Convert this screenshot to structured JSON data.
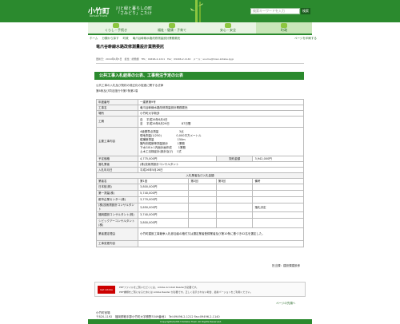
{
  "header": {
    "logo": "小竹町",
    "logo_sub": "KOTAKE TOWN",
    "tagline": "川と緑と暮らしの町「さみどり」こたけ",
    "search_placeholder": "検索キーワードを入力",
    "search_button": "検索"
  },
  "nav": [
    {
      "label": "くらし・手続き",
      "icon": "house-icon"
    },
    {
      "label": "福祉・健康・子育て",
      "icon": "people-icon"
    },
    {
      "label": "安心・安全",
      "icon": "shield-icon"
    },
    {
      "label": "町政",
      "icon": "building-icon"
    }
  ],
  "breadcrumb": [
    "ホーム",
    "分類から探す",
    "町政",
    "竜爪谷幹線水路改修測量設計業務委託"
  ],
  "print_link": "ページを印刷する",
  "page_title": "竜爪谷幹線水路改修測量設計業務委託",
  "meta_line": "更新日：2019年4月5日　担当：総務課　TEL：09496-2-1211　Fax：09496-2-1140　メール：soumu@town.kotake.lg.jp",
  "section_heading": "公共工事入札結果の公表、工事発注予定の公表",
  "intro": [
    "公共工事の入札及び契約の適正化の促進に関する法律",
    "第8条及び同法施行令第7条第2項"
  ],
  "table": {
    "rows": [
      {
        "label": "年度番号",
        "value": "一建業第9号"
      },
      {
        "label": "工事名",
        "value": "竜爪谷幹線水路改修測量設計業務委託"
      },
      {
        "label": "場所",
        "value": "小竹町大字新多"
      },
      {
        "label": "工期",
        "lines": [
          "自　 平成26年6月4日",
          "至　 平成26年8月29日　　　　 87日間"
        ]
      },
      {
        "label": "主要工事内容",
        "lines": [
          "4級基準点測量　　　　　　　 3点",
          "現地測量(1/250)　　　　　 0,000平方メートル",
          "縦横断測量　　　　　　　　 150m",
          "箇所別縦断等測量設計　　　 1業務",
          "下水GIS＊1内面計画作成　　 1業務",
          "土木工法検証計(設計及び)　 1式"
        ]
      },
      {
        "label": "予定価格",
        "value": "4,775,000円",
        "sub_label": "契約金額",
        "sub_value": "3,942,000円"
      },
      {
        "label": "落札業者",
        "value": "(株)技術測設計コンサルタント"
      },
      {
        "label": "入札年月日",
        "value": "平成26年5月26日"
      }
    ],
    "bid_heading": "入札業者及び入札金額",
    "bid_columns": [
      "業者名",
      "第1回",
      "第2回",
      "第3回",
      "備考"
    ],
    "bids": [
      {
        "name": "日本航(株)",
        "r1": "3,800,000円",
        "r2": "",
        "r3": "",
        "note": ""
      },
      {
        "name": "第一測量(株)",
        "r1": "5,740,000円",
        "r2": "",
        "r3": "",
        "note": ""
      },
      {
        "name": "都市企業センター(株)",
        "r1": "3,770,000円",
        "r2": "",
        "r3": "",
        "note": ""
      },
      {
        "name": "(株)技術測設計コンサルタント",
        "r1": "3,650,000円",
        "r2": "",
        "r3": "",
        "note": "落札決定"
      },
      {
        "name": "福岡建設コンサルタント(株)",
        "r1": "3,740,000円",
        "r2": "",
        "r3": "",
        "note": ""
      },
      {
        "name": "シビックアーコンサルタント(株)",
        "r1": "3,800,000円",
        "r2": "",
        "r3": "",
        "note": ""
      }
    ],
    "reason_label": "業者選定理由",
    "reason_value": "小竹町建設工事競争入札参加者の格付又は選定業者登録業者及び第10条に基づき02名を選定した。",
    "summary_label": "工事変更内容",
    "summary_value": ""
  },
  "footer_sign": "担当課：建設課建設係",
  "pdf_badge": "Get Adobe Reader",
  "pdf_note_1": "PDFファイルをご覧いただくには、Adobe Acrobat Readerが必要です。",
  "pdf_note_2": "PDF書類をご覧になるためには Adobe Reader が必要です。正しく表示されない場合、最新バージョンをご利用ください。",
  "top_link": "ページの先頭へ",
  "address_1": "小竹町役場",
  "address_2": "〒820-1192　福岡県鞍手郡小竹町大字勝野3349番地1　Tel:09496-2-1212 Fax:09496-2-1140",
  "copyright": "Copyright(C)2013 Kotake Town All Rights Reserved."
}
